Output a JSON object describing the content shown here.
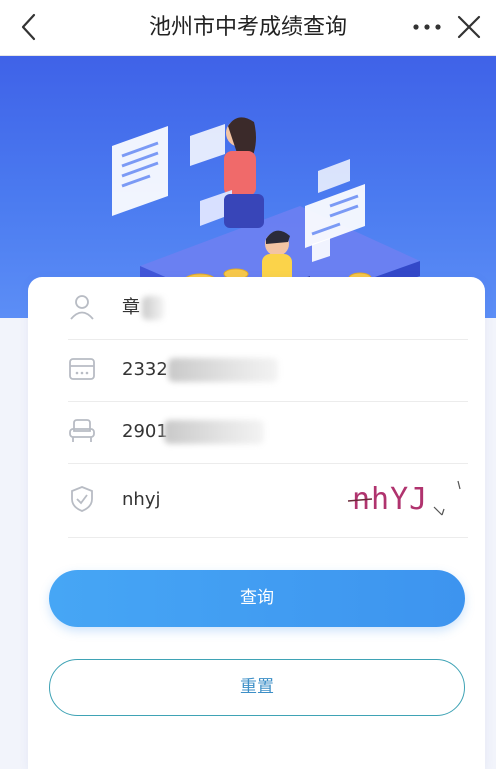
{
  "header": {
    "title": "池州市中考成绩查询",
    "back_icon": "chevron-left-icon",
    "more_icon": "more-dots-icon",
    "close_icon": "close-icon"
  },
  "form": {
    "name_value": "章",
    "exam_number_value": "2332",
    "id_value": "2901",
    "captcha_input_value": "nhyj",
    "captcha_image_text": "nhYJ",
    "query_label": "查询",
    "reset_label": "重置"
  },
  "colors": {
    "banner_blue": "#4b7bf0",
    "button_blue": "#3d94ef",
    "reset_border": "#3fa3b5",
    "captcha_magenta": "#b0336e"
  }
}
